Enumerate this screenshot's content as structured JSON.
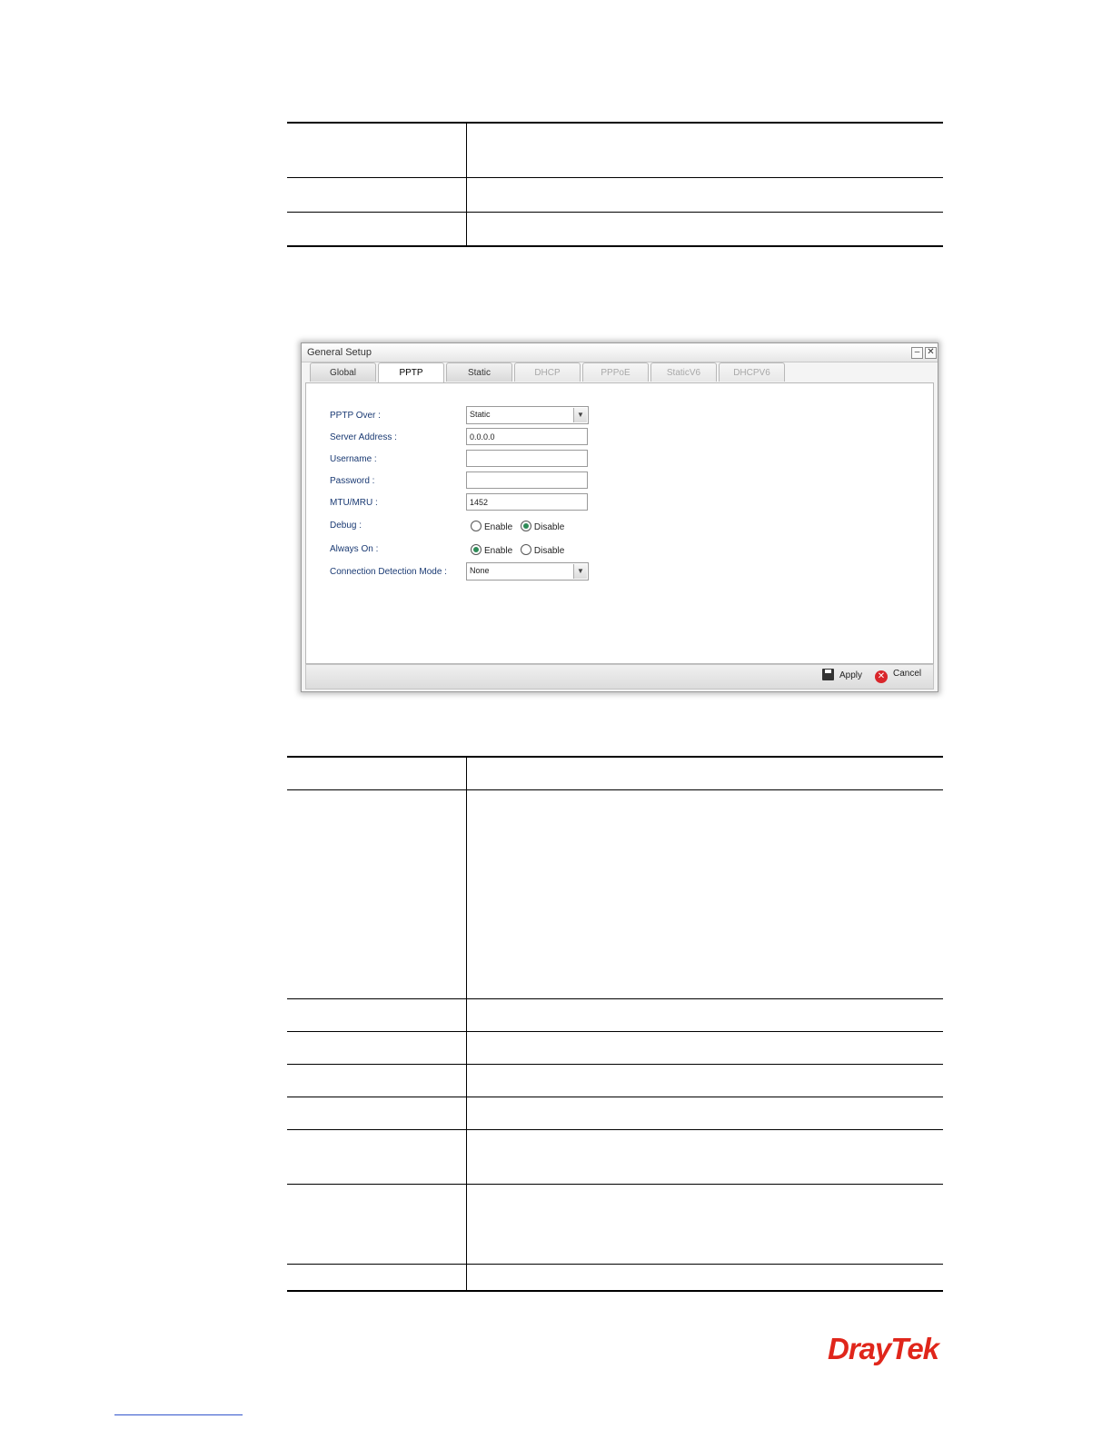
{
  "dialog": {
    "title": "General Setup",
    "minimize_glyph": "–",
    "close_glyph": "✕",
    "tabs": [
      {
        "label": "Global",
        "state": "normal"
      },
      {
        "label": "PPTP",
        "state": "active"
      },
      {
        "label": "Static",
        "state": "normal"
      },
      {
        "label": "DHCP",
        "state": "disabled"
      },
      {
        "label": "PPPoE",
        "state": "disabled"
      },
      {
        "label": "StaticV6",
        "state": "disabled"
      },
      {
        "label": "DHCPV6",
        "state": "disabled"
      }
    ],
    "form": {
      "pptp_over": {
        "label": "PPTP Over :",
        "value": "Static"
      },
      "server_address": {
        "label": "Server Address :",
        "value": "0.0.0.0"
      },
      "username": {
        "label": "Username :",
        "value": ""
      },
      "password": {
        "label": "Password :",
        "value": ""
      },
      "mtu_mru": {
        "label": "MTU/MRU :",
        "value": "1452"
      },
      "debug": {
        "label": "Debug :",
        "options": [
          "Enable",
          "Disable"
        ],
        "selected": "Disable"
      },
      "always_on": {
        "label": "Always On :",
        "options": [
          "Enable",
          "Disable"
        ],
        "selected": "Enable"
      },
      "connection_detection_mode": {
        "label": "Connection Detection Mode :",
        "value": "None"
      }
    },
    "footer": {
      "apply_label": "Apply",
      "cancel_label": "Cancel"
    },
    "select_arrow_glyph": "▼"
  },
  "logo": {
    "text": "DrayTek",
    "color": "#e0261b"
  },
  "accent_colors": {
    "label_blue": "#1a3a73",
    "radio_green": "#2e8b57",
    "cancel_red": "#d9262b"
  }
}
